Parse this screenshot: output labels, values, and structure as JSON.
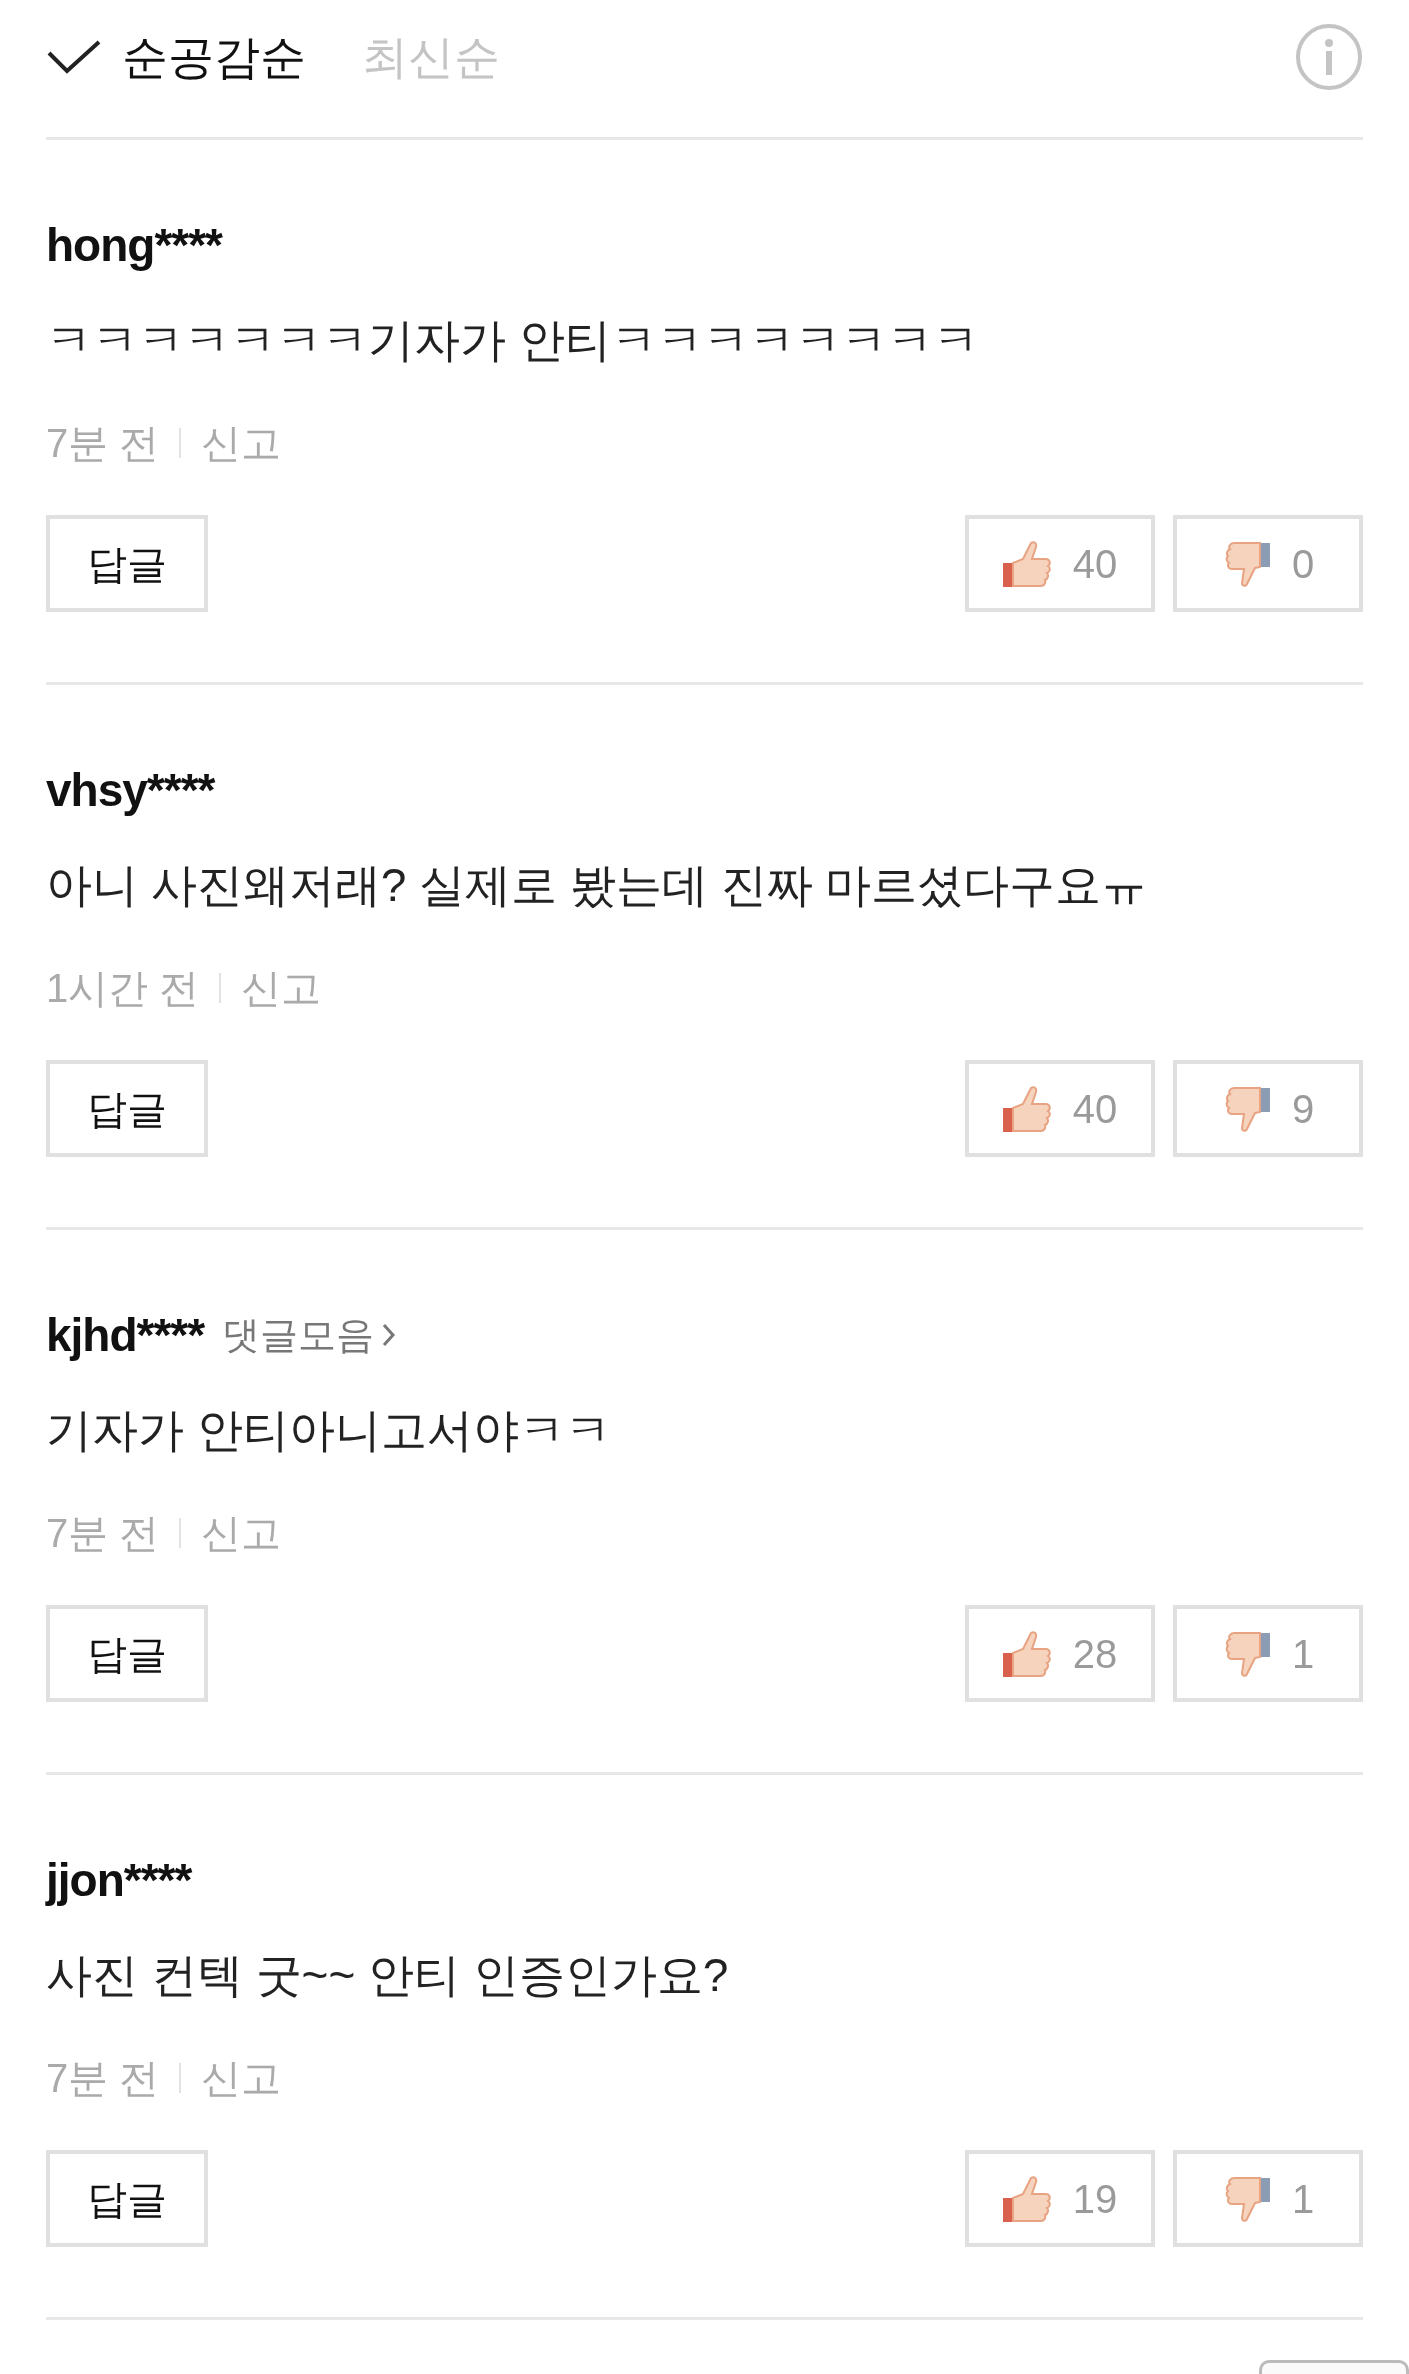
{
  "sort_tabs": [
    {
      "label": "순공감순",
      "selected": true
    },
    {
      "label": "최신순",
      "selected": false
    }
  ],
  "comments": [
    {
      "username": "hong****",
      "body": "ㅋㅋㅋㅋㅋㅋㅋ기자가 안티ㅋㅋㅋㅋㅋㅋㅋㅋ",
      "time": "7분 전",
      "report": "신고",
      "reply": "답글",
      "likes": "40",
      "dislikes": "0"
    },
    {
      "username": "vhsy****",
      "body": "아니 사진왜저래? 실제로 봤는데 진짜 마르셨다구요ㅠ",
      "time": "1시간 전",
      "report": "신고",
      "reply": "답글",
      "likes": "40",
      "dislikes": "9"
    },
    {
      "username": "kjhd****",
      "collection_link": "댓글모음",
      "body": "기자가 안티아니고서야ㅋㅋ",
      "time": "7분 전",
      "report": "신고",
      "reply": "답글",
      "likes": "28",
      "dislikes": "1"
    },
    {
      "username": "jjon****",
      "body": "사진 컨텍 굿~~ 안티 인증인가요?",
      "time": "7분 전",
      "report": "신고",
      "reply": "답글",
      "likes": "19",
      "dislikes": "1"
    }
  ]
}
